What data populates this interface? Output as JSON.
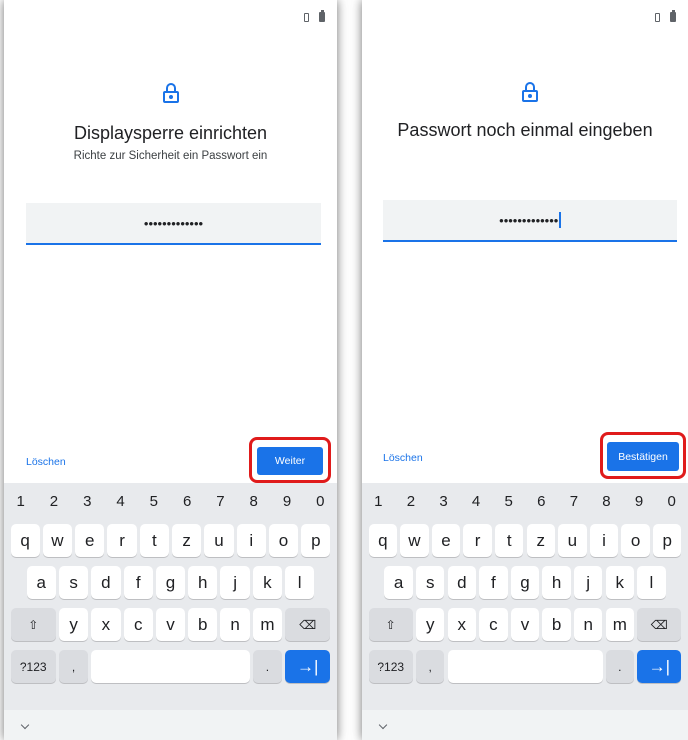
{
  "screens": [
    {
      "title": "Displaysperre einrichten",
      "subtitle": "Richte zur Sicherheit ein Passwort ein",
      "password_mask": "•••••••••••••",
      "clear_label": "Löschen",
      "primary_label": "Weiter",
      "show_cursor": false
    },
    {
      "title": "Passwort noch einmal eingeben",
      "subtitle": "",
      "password_mask": "•••••••••••••",
      "clear_label": "Löschen",
      "primary_label": "Bestätigen",
      "show_cursor": true
    }
  ],
  "keyboard": {
    "numbers": [
      "1",
      "2",
      "3",
      "4",
      "5",
      "6",
      "7",
      "8",
      "9",
      "0"
    ],
    "row1": [
      "q",
      "w",
      "e",
      "r",
      "t",
      "z",
      "u",
      "i",
      "o",
      "p"
    ],
    "row2": [
      "a",
      "s",
      "d",
      "f",
      "g",
      "h",
      "j",
      "k",
      "l"
    ],
    "row3": [
      "y",
      "x",
      "c",
      "v",
      "b",
      "n",
      "m"
    ],
    "symbols_label": "?123",
    "comma": ",",
    "period": ".",
    "shift_icon": "⇧",
    "backspace_icon": "⌫",
    "enter_icon": "→|"
  },
  "colors": {
    "accent": "#1a73e8",
    "highlight": "#e01b1b"
  }
}
